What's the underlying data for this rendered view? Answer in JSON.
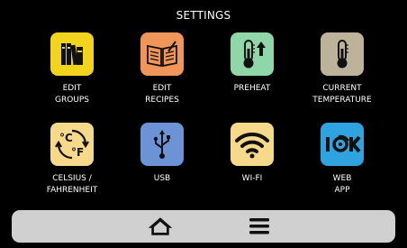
{
  "header": {
    "title": "SETTINGS"
  },
  "tiles": [
    {
      "label": "EDIT\nGROUPS",
      "icon": "books-icon",
      "color": "#f2d41e"
    },
    {
      "label": "EDIT\nRECIPES",
      "icon": "recipe-book-icon",
      "color": "#f0965a"
    },
    {
      "label": "PREHEAT",
      "icon": "thermometer-up-icon",
      "color": "#8fd6a8"
    },
    {
      "label": "CURRENT\nTEMPERATURE",
      "icon": "thermometer-icon",
      "color": "#bcb39a"
    },
    {
      "label": "CELSIUS /\nFAHRENHEIT",
      "icon": "celsius-fahrenheit-icon",
      "color": "#f7d98b"
    },
    {
      "label": "USB",
      "icon": "usb-icon",
      "color": "#6b93d6"
    },
    {
      "label": "WI-FI",
      "icon": "wifi-icon",
      "color": "#f7d98b"
    },
    {
      "label": "WEB\nAPP",
      "icon": "web-app-icon",
      "color": "#2fa2e0"
    }
  ],
  "bottom_nav": {
    "home_icon": "home-icon",
    "menu_icon": "menu-icon",
    "bar_color": "#d0d0d0"
  }
}
